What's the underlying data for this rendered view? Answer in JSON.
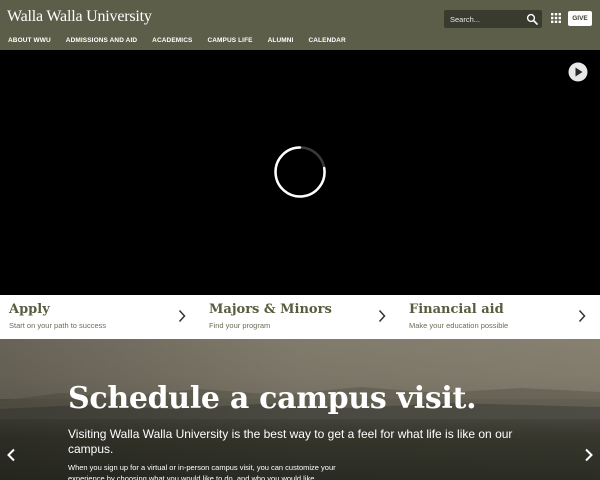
{
  "header": {
    "logo_text": "Walla Walla University",
    "search_placeholder": "Search...",
    "give_label": "GIVE",
    "nav": [
      "ABOUT WWU",
      "ADMISSIONS AND AID",
      "ACADEMICS",
      "CAMPUS LIFE",
      "ALUMNI",
      "CALENDAR"
    ]
  },
  "quicklinks": [
    {
      "title": "Apply",
      "subtitle": "Start on your path to success"
    },
    {
      "title": "Majors & Minors",
      "subtitle": "Find your program"
    },
    {
      "title": "Financial aid",
      "subtitle": "Make your education possible"
    }
  ],
  "hero": {
    "title": "Schedule a campus visit.",
    "lead": "Visiting Walla Walla University is the best way to get a feel for what life is like on our campus.",
    "body": "When you sign up for a virtual or in-person campus visit, you can customize your experience by choosing what you would like to do, and who you would like"
  },
  "colors": {
    "header_bg": "#5c5e4a",
    "accent_olive": "#5a5c3f",
    "white": "#ffffff"
  },
  "icons": {
    "search": "search-icon",
    "apps": "apps-grid-icon",
    "play": "play-icon",
    "spinner": "loading-spinner-icon",
    "chevron": "chevron-right-icon",
    "arrow_left": "arrow-left-icon",
    "arrow_right": "arrow-right-icon"
  }
}
